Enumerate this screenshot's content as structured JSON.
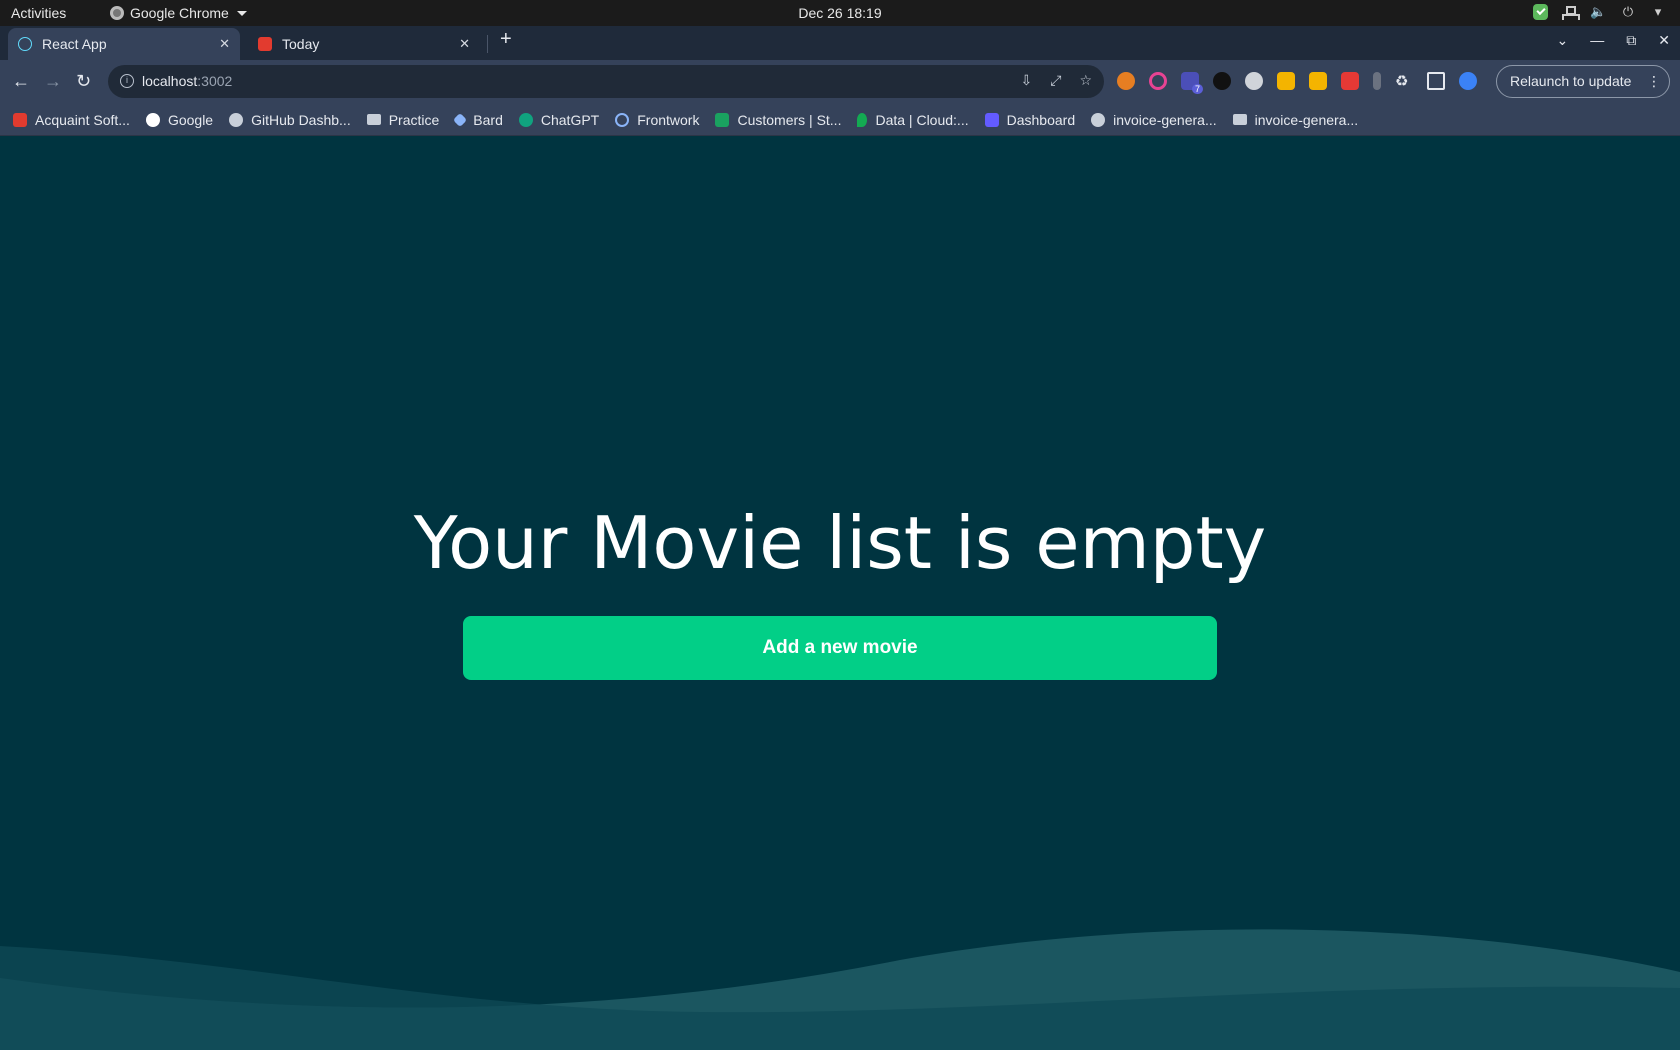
{
  "system_bar": {
    "activities": "Activities",
    "app_name": "Google Chrome",
    "clock": "Dec 26  18:19"
  },
  "tabs": [
    {
      "title": "React App",
      "active": true,
      "icon": "react-icon"
    },
    {
      "title": "Today",
      "active": false,
      "icon": "today-icon"
    }
  ],
  "omnibox": {
    "host": "localhost",
    "port": ":3002"
  },
  "relaunch_label": "Relaunch to update",
  "extensions_badge": "7",
  "bookmarks": [
    {
      "label": "Acquaint Soft...",
      "icon": "acquaint-icon",
      "color": "#e23b2f"
    },
    {
      "label": "Google",
      "icon": "google-icon",
      "color": "#ffffff"
    },
    {
      "label": "GitHub Dashb...",
      "icon": "github-icon",
      "color": "#c8cfd9"
    },
    {
      "label": "Practice",
      "icon": "folder-icon",
      "color": "#c8cfd9"
    },
    {
      "label": "Bard",
      "icon": "bard-icon",
      "color": "#8ab4f8"
    },
    {
      "label": "ChatGPT",
      "icon": "chatgpt-icon",
      "color": "#10a37f"
    },
    {
      "label": "Frontwork",
      "icon": "frontwork-icon",
      "color": "#5b6b8a"
    },
    {
      "label": "Customers | St...",
      "icon": "customers-icon",
      "color": "#1aa260"
    },
    {
      "label": "Data | Cloud:...",
      "icon": "mongodb-icon",
      "color": "#13aa52"
    },
    {
      "label": "Dashboard",
      "icon": "dashboard-icon",
      "color": "#635bff"
    },
    {
      "label": "invoice-genera...",
      "icon": "github-icon",
      "color": "#c8cfd9"
    },
    {
      "label": "invoice-genera...",
      "icon": "folder-icon",
      "color": "#c8cfd9"
    }
  ],
  "page": {
    "headline": "Your Movie list is empty",
    "add_button": "Add a new movie",
    "colors": {
      "background": "#003440",
      "button": "#02cf87",
      "wave_front": "#1e5a64",
      "wave_back": "#0f4a56"
    }
  }
}
